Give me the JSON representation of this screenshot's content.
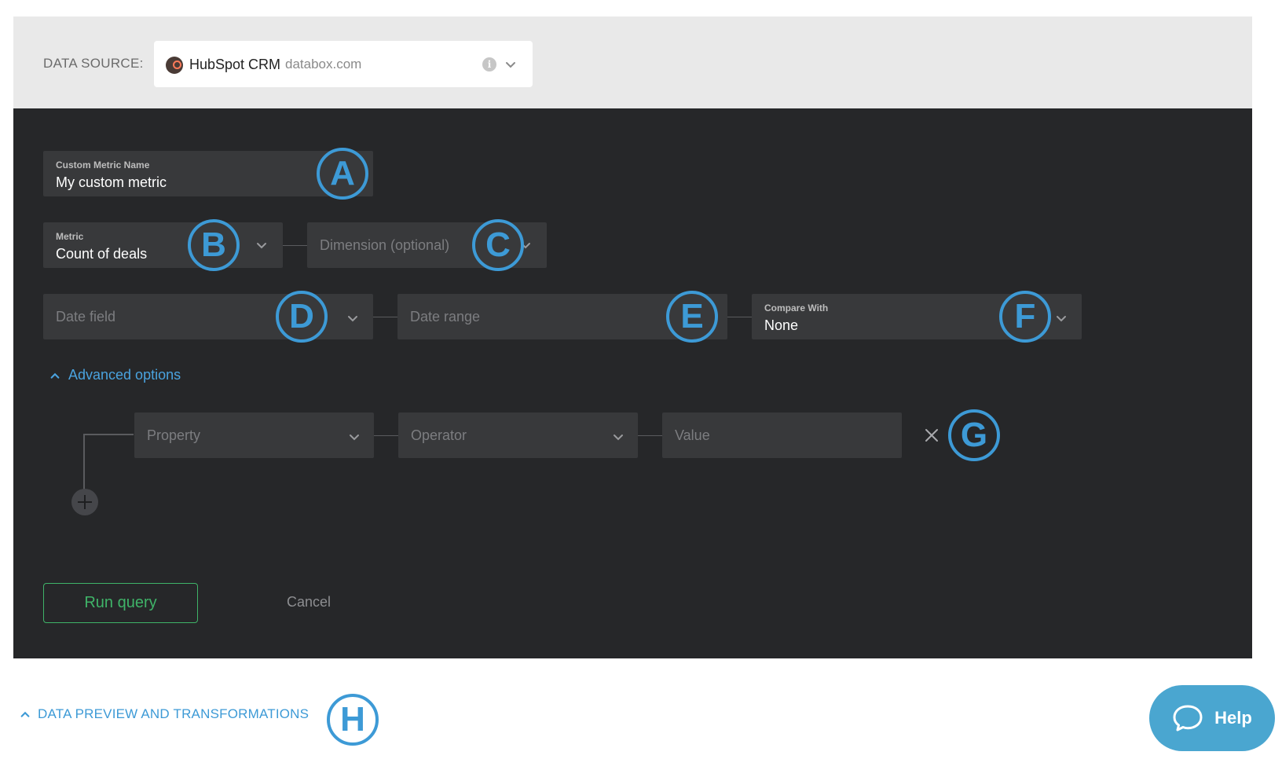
{
  "data_source": {
    "label": "DATA SOURCE:",
    "name": "HubSpot CRM",
    "domain": "databox.com",
    "info_glyph": "i"
  },
  "form": {
    "metric_name": {
      "label": "Custom Metric Name",
      "value": "My custom metric"
    },
    "metric": {
      "label": "Metric",
      "value": "Count of deals"
    },
    "dimension": {
      "placeholder": "Dimension (optional)"
    },
    "date_field": {
      "placeholder": "Date field"
    },
    "date_range": {
      "placeholder": "Date range"
    },
    "compare_with": {
      "label": "Compare With",
      "value": "None"
    },
    "advanced_options_label": "Advanced options",
    "filter": {
      "property_placeholder": "Property",
      "operator_placeholder": "Operator",
      "value_placeholder": "Value"
    },
    "run_label": "Run query",
    "cancel_label": "Cancel"
  },
  "preview_toggle_label": "DATA PREVIEW AND TRANSFORMATIONS",
  "help_label": "Help",
  "annotations": [
    "A",
    "B",
    "C",
    "D",
    "E",
    "F",
    "G",
    "H"
  ],
  "colors": {
    "accent_blue": "#3d9ad6",
    "run_green": "#3fb368",
    "panel_dark": "#262729",
    "field_bg": "#38393b",
    "help_bg": "#4aa6d0"
  },
  "icons": {
    "data_source_logo": "hubspot-logo-icon",
    "info": "info-icon",
    "dropdown": "chevron-down-icon",
    "collapse": "chevron-up-icon",
    "remove": "close-icon",
    "add": "plus-icon",
    "help": "chat-bubble-icon"
  }
}
